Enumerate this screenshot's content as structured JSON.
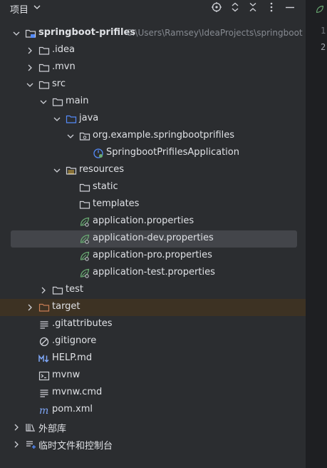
{
  "panel": {
    "title": "项目"
  },
  "header_icons": [
    "crosshair-icon",
    "expand-collapse-icon",
    "collapse-all-icon",
    "more-options-icon",
    "minimize-icon"
  ],
  "tree": [
    {
      "name": "springboot-prifiles",
      "path": "C:\\Users\\Ramsey\\IdeaProjects\\springboot",
      "icon": "module-folder-icon",
      "expanded": true
    },
    {
      "name": ".idea",
      "icon": "folder-icon",
      "expanded": false
    },
    {
      "name": ".mvn",
      "icon": "folder-icon",
      "expanded": false
    },
    {
      "name": "src",
      "icon": "folder-icon",
      "expanded": true
    },
    {
      "name": "main",
      "icon": "folder-icon",
      "expanded": true
    },
    {
      "name": "java",
      "icon": "source-folder-icon",
      "expanded": true
    },
    {
      "name": "org.example.springbootprifiles",
      "icon": "package-icon",
      "expanded": true
    },
    {
      "name": "SpringbootPrifilesApplication",
      "icon": "spring-boot-app-icon"
    },
    {
      "name": "resources",
      "icon": "resources-folder-icon",
      "expanded": true
    },
    {
      "name": "static",
      "icon": "folder-icon"
    },
    {
      "name": "templates",
      "icon": "folder-icon"
    },
    {
      "name": "application.properties",
      "icon": "spring-properties-icon"
    },
    {
      "name": "application-dev.properties",
      "icon": "spring-properties-icon",
      "selected": true
    },
    {
      "name": "application-pro.properties",
      "icon": "spring-properties-icon"
    },
    {
      "name": "application-test.properties",
      "icon": "spring-properties-icon"
    },
    {
      "name": "test",
      "icon": "folder-icon",
      "expanded": false
    },
    {
      "name": "target",
      "icon": "excluded-folder-icon",
      "expanded": false,
      "excluded": true
    },
    {
      "name": ".gitattributes",
      "icon": "text-file-icon"
    },
    {
      "name": ".gitignore",
      "icon": "ignore-file-icon"
    },
    {
      "name": "HELP.md",
      "icon": "markdown-icon"
    },
    {
      "name": "mvnw",
      "icon": "shell-script-icon"
    },
    {
      "name": "mvnw.cmd",
      "icon": "text-file-icon"
    },
    {
      "name": "pom.xml",
      "icon": "maven-icon"
    },
    {
      "name": "外部库",
      "icon": "libraries-icon",
      "expanded": false
    },
    {
      "name": "临时文件和控制台",
      "icon": "scratches-icon",
      "expanded": false
    }
  ],
  "editor": {
    "line_numbers": [
      "1",
      "2"
    ]
  },
  "colors": {
    "background": "#2b2d30",
    "selection": "#43454a",
    "excluded_row": "#3d3223",
    "spring_green": "#6aab73",
    "folder_blue": "#548af7",
    "excluded_orange": "#c77d55"
  }
}
